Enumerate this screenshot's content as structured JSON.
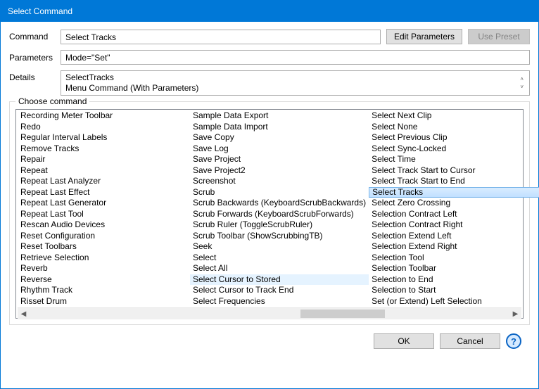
{
  "title": "Select Command",
  "fields": {
    "command_label": "Command",
    "command_value": "Select Tracks",
    "parameters_label": "Parameters",
    "parameters_value": "Mode=\"Set\"",
    "details_label": "Details",
    "details_line1": "SelectTracks",
    "details_line2": "Menu Command (With Parameters)"
  },
  "buttons": {
    "edit_parameters": "Edit Parameters",
    "use_preset": "Use Preset",
    "ok": "OK",
    "cancel": "Cancel"
  },
  "fieldset_label": "Choose command",
  "columns": [
    [
      "Recording Meter Toolbar",
      "Redo",
      "Regular Interval Labels",
      "Remove Tracks",
      "Repair",
      "Repeat",
      "Repeat Last Analyzer",
      "Repeat Last Effect",
      "Repeat Last Generator",
      "Repeat Last Tool",
      "Rescan Audio Devices",
      "Reset Configuration",
      "Reset Toolbars",
      "Retrieve Selection",
      "Reverb",
      "Reverse",
      "Rhythm Track",
      "Risset Drum"
    ],
    [
      "Sample Data Export",
      "Sample Data Import",
      "Save Copy",
      "Save Log",
      "Save Project",
      "Save Project2",
      "Screenshot",
      "Scrub",
      "Scrub Backwards (KeyboardScrubBackwards)",
      "Scrub Forwards (KeyboardScrubForwards)",
      "Scrub Ruler (ToggleScrubRuler)",
      "Scrub Toolbar (ShowScrubbingTB)",
      "Seek",
      "Select",
      "Select All",
      "Select Cursor to Stored",
      "Select Cursor to Track End",
      "Select Frequencies"
    ],
    [
      "Select Next Clip",
      "Select None",
      "Select Previous Clip",
      "Select Sync-Locked",
      "Select Time",
      "Select Track Start to Cursor",
      "Select Track Start to End",
      "Select Tracks",
      "Select Zero Crossing",
      "Selection Contract Left",
      "Selection Contract Right",
      "Selection Extend Left",
      "Selection Extend Right",
      "Selection Tool",
      "Selection Toolbar",
      "Selection to End",
      "Selection to Start",
      "Set (or Extend) Left Selection"
    ]
  ],
  "selected": "Select Tracks",
  "hover": "Select Cursor to Stored"
}
